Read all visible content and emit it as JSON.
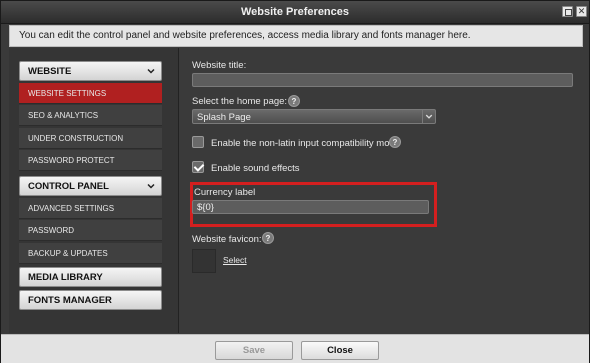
{
  "window": {
    "title": "Website Preferences"
  },
  "info": "You can edit the control panel and website preferences, access media library and fonts manager here.",
  "sidebar": {
    "website": {
      "label": "WEBSITE",
      "items": [
        "WEBSITE SETTINGS",
        "SEO & ANALYTICS",
        "UNDER CONSTRUCTION",
        "PASSWORD PROTECT"
      ]
    },
    "control_panel": {
      "label": "CONTROL PANEL",
      "items": [
        "ADVANCED SETTINGS",
        "PASSWORD",
        "BACKUP & UPDATES"
      ]
    },
    "media_library": "MEDIA LIBRARY",
    "fonts_manager": "FONTS MANAGER"
  },
  "form": {
    "website_title_label": "Website title:",
    "website_title_value": "",
    "home_page_label": "Select the home page:",
    "home_page_value": "Splash Page",
    "nonlatin_label": "Enable the non-latin input compatibility mode",
    "nonlatin_checked": false,
    "sound_label": "Enable sound effects",
    "sound_checked": true,
    "currency_label": "Currency label",
    "currency_value": "${0}",
    "favicon_label": "Website favicon:",
    "favicon_link": "Select"
  },
  "footer": {
    "save": "Save",
    "close": "Close"
  },
  "colors": {
    "active_item": "#b02020",
    "highlight": "#d41f1f"
  }
}
